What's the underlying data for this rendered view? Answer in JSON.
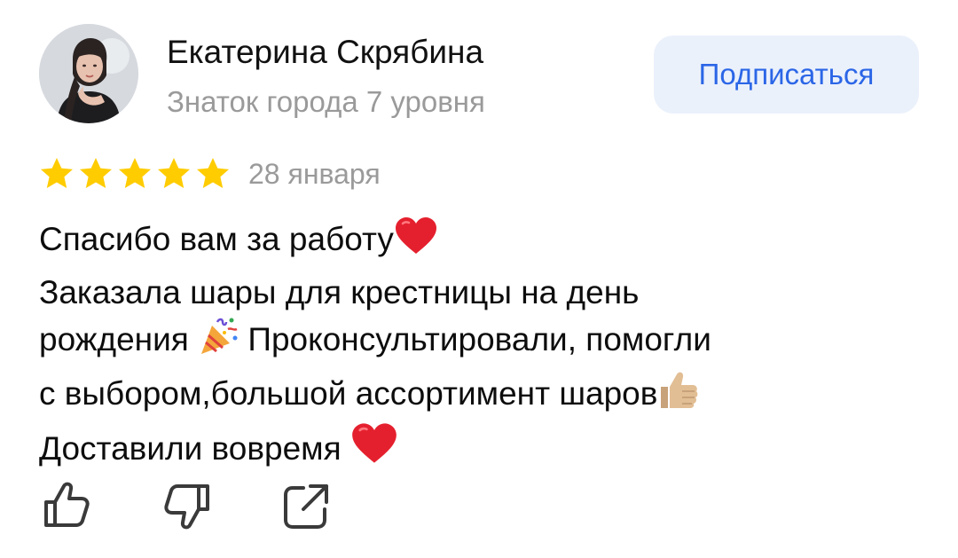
{
  "author": {
    "name": "Екатерина Скрябина",
    "rank": "Знаток города 7 уровня",
    "avatar_icon": "user-avatar-photo"
  },
  "subscribe": {
    "label": "Подписаться"
  },
  "review": {
    "rating": 5,
    "rating_max": 5,
    "date": "28 января",
    "lines": [
      {
        "text": "Спасибо вам за работу",
        "emoji": "red-heart-icon"
      },
      {
        "text": "Заказала шары для крестницы на день",
        "emoji": ""
      },
      {
        "text": "рождения ",
        "emoji": "party-popper-icon",
        "text_after": " Проконсультировали, помогли"
      },
      {
        "text": "с выбором,большой ассортимент шаров",
        "emoji": "thumbs-up-icon"
      },
      {
        "text": "Доставили вовремя ",
        "emoji": "red-heart-icon"
      }
    ]
  },
  "actions": {
    "like_icon": "thumbs-up-outline-icon",
    "dislike_icon": "thumbs-down-outline-icon",
    "share_icon": "share-icon"
  },
  "colors": {
    "star": "#FFCC00",
    "subscribe_bg": "#EBF1FB",
    "subscribe_text": "#2B66E7",
    "muted_text": "#9A9A9A",
    "heart": "#E5202E",
    "icon_stroke": "#3A3A3A"
  }
}
